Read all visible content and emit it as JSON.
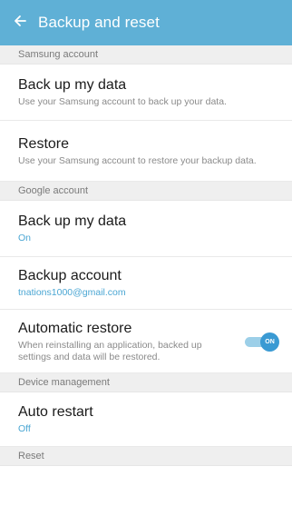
{
  "appbar": {
    "title": "Backup and reset",
    "back_icon": "arrow-left-icon"
  },
  "sections": {
    "samsung": "Samsung account",
    "google": "Google account",
    "device": "Device management",
    "reset": "Reset"
  },
  "items": {
    "samsung_backup": {
      "title": "Back up my data",
      "sub": "Use your Samsung account to back up your data."
    },
    "restore": {
      "title": "Restore",
      "sub": "Use your Samsung account to restore your backup data."
    },
    "google_backup": {
      "title": "Back up my data",
      "sub": "On"
    },
    "backup_account": {
      "title": "Backup account",
      "sub": "tnations1000@gmail.com"
    },
    "auto_restore": {
      "title": "Automatic restore",
      "sub": "When reinstalling an application, backed up settings and data will be restored.",
      "toggle_label": "ON"
    },
    "auto_restart": {
      "title": "Auto restart",
      "sub": "Off"
    }
  },
  "colors": {
    "accent": "#5fb0d6",
    "link": "#4aa6d3",
    "toggle": "#3a9ad3"
  }
}
